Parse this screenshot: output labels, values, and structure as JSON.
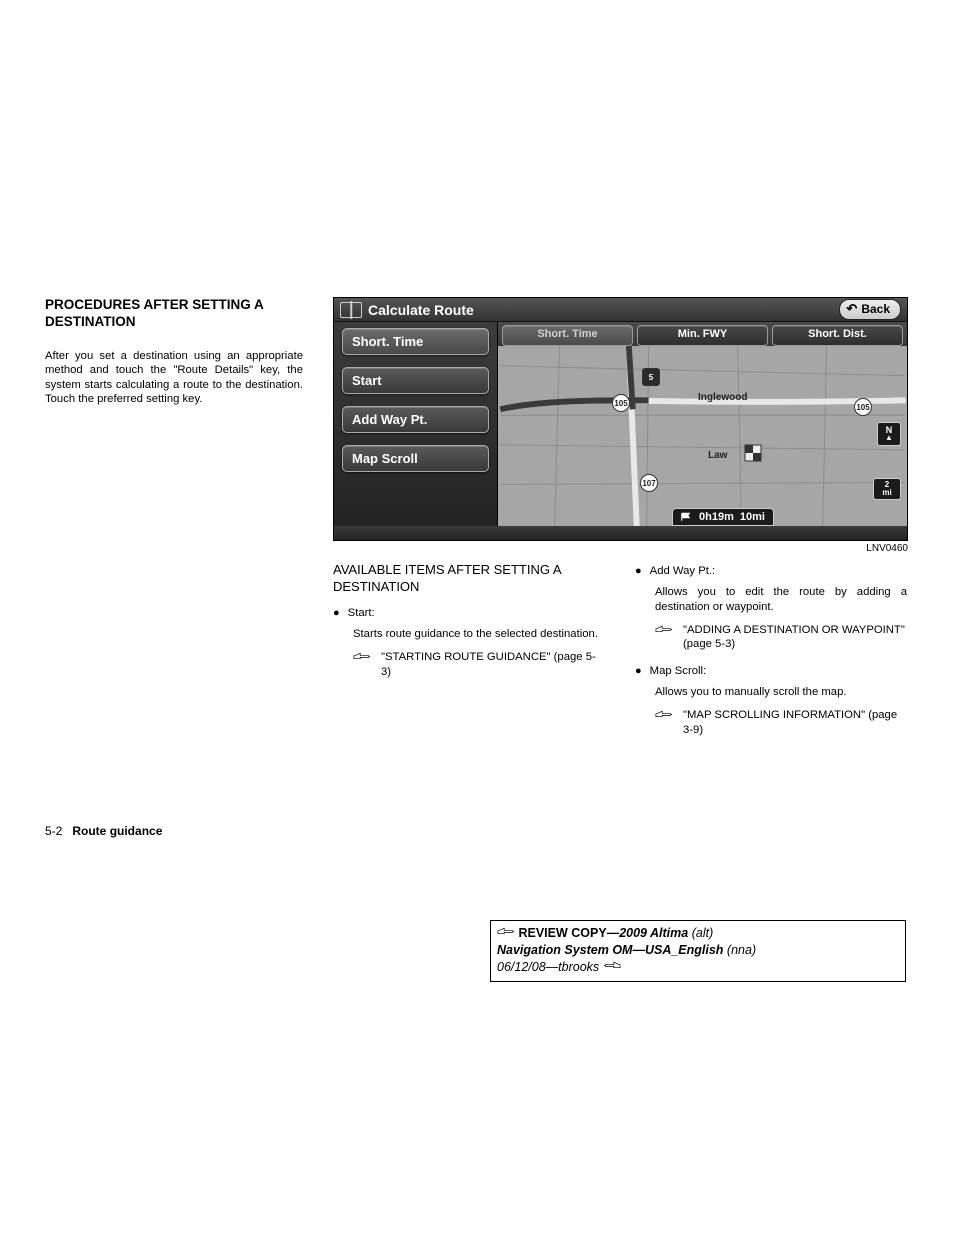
{
  "heading": "PROCEDURES AFTER SETTING A DESTINATION",
  "intro": "After you set a destination using an appropriate method and touch the \"Route Details\" key, the system starts calculating a route to the destination. Touch the preferred setting key.",
  "screenshot": {
    "title": "Calculate Route",
    "back": "Back",
    "side_buttons": [
      "Short. Time",
      "Start",
      "Add Way Pt.",
      "Map Scroll"
    ],
    "tabs": [
      "Short. Time",
      "Min. FWY",
      "Short. Dist."
    ],
    "map_labels": {
      "inglewood": "Inglewood",
      "lawndale_partial": "Law",
      "shields": {
        "i5": "5",
        "r105a": "105",
        "r105b": "105",
        "r107": "107"
      }
    },
    "scale_top": "2",
    "scale_bottom": "mi",
    "status": {
      "time": "0h19m",
      "dist": "10mi"
    },
    "caption": "LNV0460"
  },
  "subhead": "AVAILABLE ITEMS AFTER SETTING A DESTINATION",
  "items": {
    "start": {
      "label": "Start:",
      "desc": "Starts route guidance to the selected destination.",
      "ref": "\"STARTING ROUTE GUIDANCE\" (page 5-3)"
    },
    "add": {
      "label": "Add Way Pt.:",
      "desc": "Allows you to edit the route by adding a destination or waypoint.",
      "ref": "\"ADDING A DESTINATION OR WAYPOINT\" (page 5-3)"
    },
    "scroll": {
      "label": "Map Scroll:",
      "desc": "Allows you to manually scroll the map.",
      "ref": "\"MAP SCROLLING INFORMATION\" (page 3-9)"
    }
  },
  "footer": {
    "page": "5-2",
    "section": "Route guidance"
  },
  "review": {
    "l1a": "REVIEW COPY—",
    "l1b": "2009 Altima",
    "l1c": "(alt)",
    "l2a": "Navigation System OM—USA_English",
    "l2b": "(nna)",
    "l3": "06/12/08—tbrooks"
  }
}
